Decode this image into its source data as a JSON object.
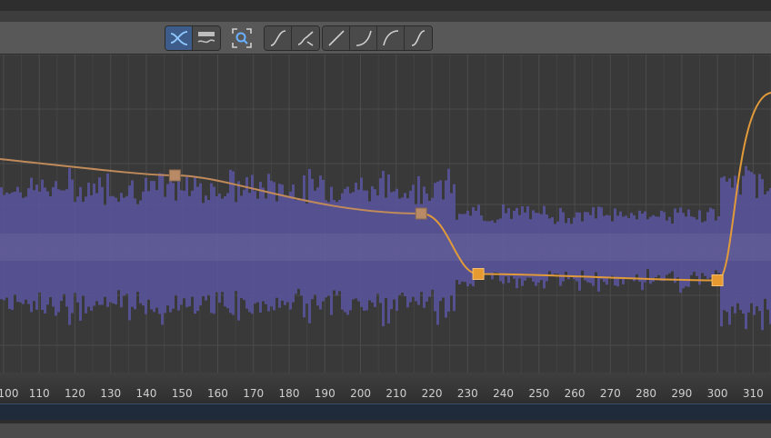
{
  "toolbar": {
    "groups": [
      {
        "name": "view-mode",
        "buttons": [
          "curve-view-icon",
          "dopesheet-view-icon"
        ]
      },
      {
        "name": "zoom",
        "buttons": [
          "zoom-fit-icon"
        ]
      },
      {
        "name": "tangent-a",
        "buttons": [
          "smooth-tangent-icon",
          "broken-tangent-icon"
        ]
      },
      {
        "name": "tangent-b",
        "buttons": [
          "linear-tangent-icon",
          "ease-in-icon",
          "ease-out-icon",
          "auto-tangent-icon"
        ]
      }
    ],
    "active_button": "curve-view-icon"
  },
  "timeline": {
    "ticks": [
      "100",
      "110",
      "120",
      "130",
      "140",
      "150",
      "160",
      "170",
      "180",
      "190",
      "200",
      "210",
      "220",
      "230",
      "240",
      "250",
      "260",
      "270",
      "280",
      "290",
      "300",
      "310"
    ],
    "range": [
      99,
      315
    ]
  },
  "curve": {
    "keyframes": [
      {
        "frame": 148,
        "value": 0.62,
        "selected": false
      },
      {
        "frame": 217,
        "value": 0.5,
        "selected": false
      },
      {
        "frame": 233,
        "value": 0.31,
        "selected": true
      },
      {
        "frame": 300,
        "value": 0.29,
        "selected": true
      }
    ]
  },
  "colors": {
    "curve": "#e09a3a",
    "curve_dim": "#c08a5a",
    "key": "#e69a30",
    "key_dim": "#b88a66",
    "waveform": "#5a55a0",
    "accent": "#3e5c8a"
  }
}
